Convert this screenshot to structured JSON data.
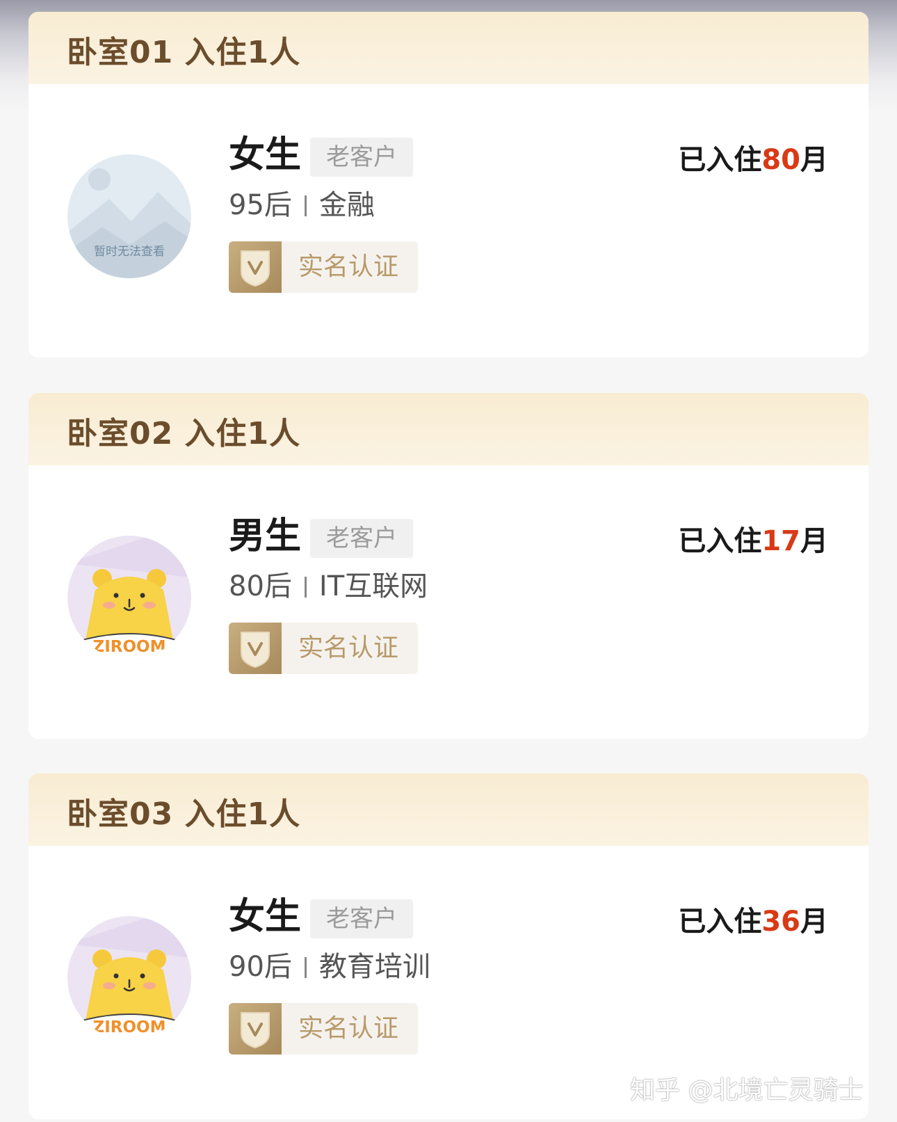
{
  "rooms": [
    {
      "title": "卧室01  入住1人",
      "gender": "女生",
      "tag": "老客户",
      "age": "95后",
      "industry": "金融",
      "verify_label": "实名认证",
      "months_prefix": "已入住",
      "months_value": "80",
      "months_suffix": "月",
      "avatar_type": "placeholder",
      "avatar_text": "暂时无法查看"
    },
    {
      "title": "卧室02  入住1人",
      "gender": "男生",
      "tag": "老客户",
      "age": "80后",
      "industry": "IT互联网",
      "verify_label": "实名认证",
      "months_prefix": "已入住",
      "months_value": "17",
      "months_suffix": "月",
      "avatar_type": "ziroom-bear",
      "avatar_text": "ZIROOM"
    },
    {
      "title": "卧室03  入住1人",
      "gender": "女生",
      "tag": "老客户",
      "age": "90后",
      "industry": "教育培训",
      "verify_label": "实名认证",
      "months_prefix": "已入住",
      "months_value": "36",
      "months_suffix": "月",
      "avatar_type": "ziroom-bear",
      "avatar_text": "ZIROOM"
    }
  ],
  "watermark": "知乎 @北境亡灵骑士",
  "colors": {
    "header_bg": "#f8ecd2",
    "title_text": "#6b4d2c",
    "months_accent": "#d83a16",
    "verify_gold": "#b89a6a"
  }
}
